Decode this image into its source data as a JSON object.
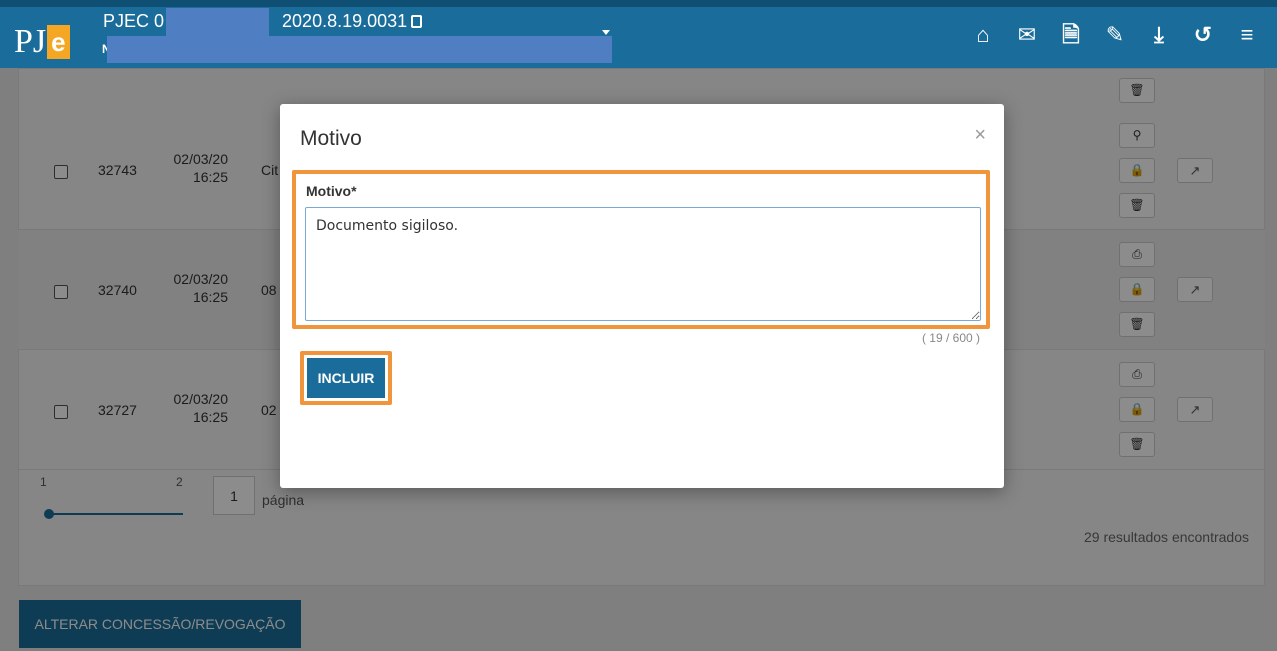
{
  "header": {
    "logo_pj": "PJ",
    "logo_e": "e",
    "process_prefix": "PJEC 0",
    "process_suffix": "2020.8.19.0031",
    "redacted_initial": "N",
    "icons": [
      "home-icon",
      "mail-icon",
      "new-document-icon",
      "edit-icon",
      "download-icon",
      "history-icon",
      "menu-icon"
    ]
  },
  "table": {
    "rows": [
      {
        "id": "32743",
        "date": "02/03/20",
        "time": "16:25",
        "desc": "Cit"
      },
      {
        "id": "32740",
        "date": "02/03/20",
        "time": "16:25",
        "desc": "08"
      },
      {
        "id": "32727",
        "date": "02/03/20",
        "time": "16:25",
        "desc": "02"
      }
    ],
    "pager": {
      "label_1": "1",
      "label_2": "2",
      "current_page": "1",
      "page_word": "página"
    },
    "results": "29 resultados encontrados"
  },
  "actions": {
    "alterar": "ALTERAR CONCESSÃO/REVOGAÇÃO"
  },
  "modal": {
    "title": "Motivo",
    "close": "×",
    "field_label": "Motivo*",
    "field_value": "Documento sigiloso.",
    "char_count": "( 19 / 600 )",
    "submit": "INCLUIR"
  },
  "colors": {
    "header": "#1a6d9a",
    "highlight": "#f0953b"
  }
}
